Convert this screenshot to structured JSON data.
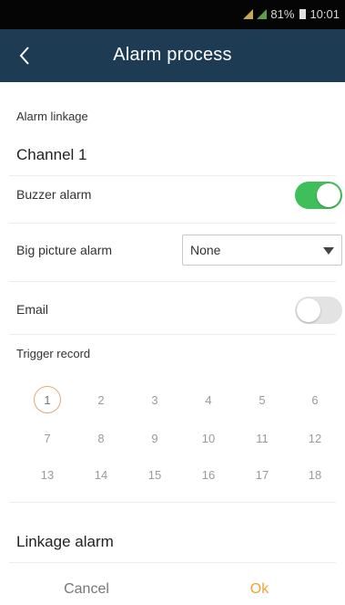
{
  "status_bar": {
    "battery": "81%",
    "time": "10:01"
  },
  "header": {
    "title": "Alarm process"
  },
  "alarm_linkage": {
    "label": "Alarm linkage",
    "channel": "Channel 1"
  },
  "buzzer": {
    "label": "Buzzer alarm",
    "enabled": true
  },
  "big_picture": {
    "label": "Big picture alarm",
    "selected": "None"
  },
  "email": {
    "label": "Email",
    "enabled": false
  },
  "trigger_record": {
    "label": "Trigger record",
    "channels": [
      "1",
      "2",
      "3",
      "4",
      "5",
      "6",
      "7",
      "8",
      "9",
      "10",
      "11",
      "12",
      "13",
      "14",
      "15",
      "16",
      "17",
      "18"
    ],
    "selected": [
      "1"
    ]
  },
  "linkage_alarm": {
    "label": "Linkage alarm"
  },
  "footer": {
    "cancel": "Cancel",
    "ok": "Ok"
  },
  "colors": {
    "header": "#1d3b53",
    "toggle_on": "#3fbf5a",
    "ok": "#f0a23a",
    "selected_ring": "#e6a873"
  }
}
